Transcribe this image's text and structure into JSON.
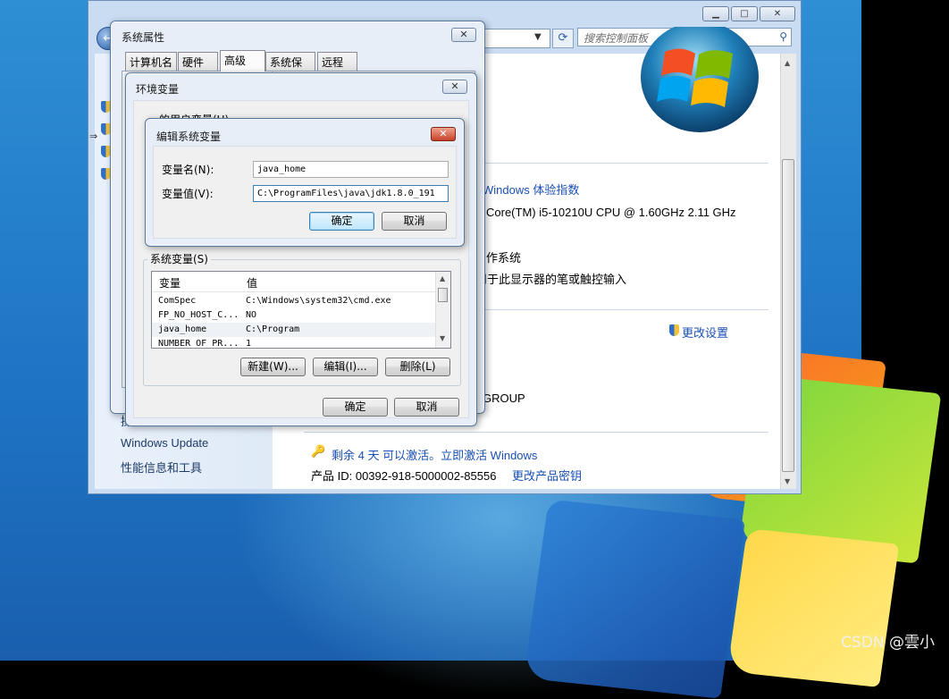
{
  "desktop": {
    "watermark": "CSDN @雲小"
  },
  "control_panel": {
    "search_placeholder": "搜索控制面板",
    "sidebar_links": [
      "Windows Update",
      "性能信息和工具"
    ],
    "sidebar_partial": "操",
    "lines": {
      "rating": "Windows 体验指数",
      "cpu": "Core(TM) i5-10210U CPU @ 1.60GHz   2.11 GHz",
      "os_type": "作系统",
      "pen": "用于此显示器的笔或触控输入",
      "change_settings": "更改设置",
      "workgroup": "GROUP",
      "activation": "剩余 4 天 可以激活。立即激活 Windows",
      "product_id": "产品 ID: 00392-918-5000002-85556",
      "change_key": "更改产品密钥"
    }
  },
  "sys_props": {
    "title": "系统属性",
    "close": "✕",
    "tabs": [
      "计算机名",
      "硬件",
      "高级",
      "系统保护",
      "远程"
    ]
  },
  "env_vars": {
    "title": "环境变量",
    "close": "✕",
    "user_vars_label": "的用户变量(U)",
    "system_vars_label": "系统变量(S)",
    "columns": [
      "变量",
      "值"
    ],
    "rows": [
      {
        "name": "ComSpec",
        "value": "C:\\Windows\\system32\\cmd.exe"
      },
      {
        "name": "FP_NO_HOST_C...",
        "value": "NO"
      },
      {
        "name": "java_home",
        "value": "C:\\Program"
      },
      {
        "name": "NUMBER_OF_PR...",
        "value": "1"
      }
    ],
    "buttons": {
      "new": "新建(W)...",
      "edit": "编辑(I)...",
      "delete": "删除(L)",
      "ok": "确定",
      "cancel": "取消"
    }
  },
  "edit_var": {
    "title": "编辑系统变量",
    "close": "✕",
    "name_label": "变量名(N):",
    "value_label": "变量值(V):",
    "name_value": "java_home",
    "value_value": "C:\\ProgramFiles\\java\\jdk1.8.0_191",
    "ok": "确定",
    "cancel": "取消"
  },
  "colors": {
    "link": "#1a4fb5",
    "dialog_bg": "#e7eef7",
    "face": "#f0f0f0"
  }
}
